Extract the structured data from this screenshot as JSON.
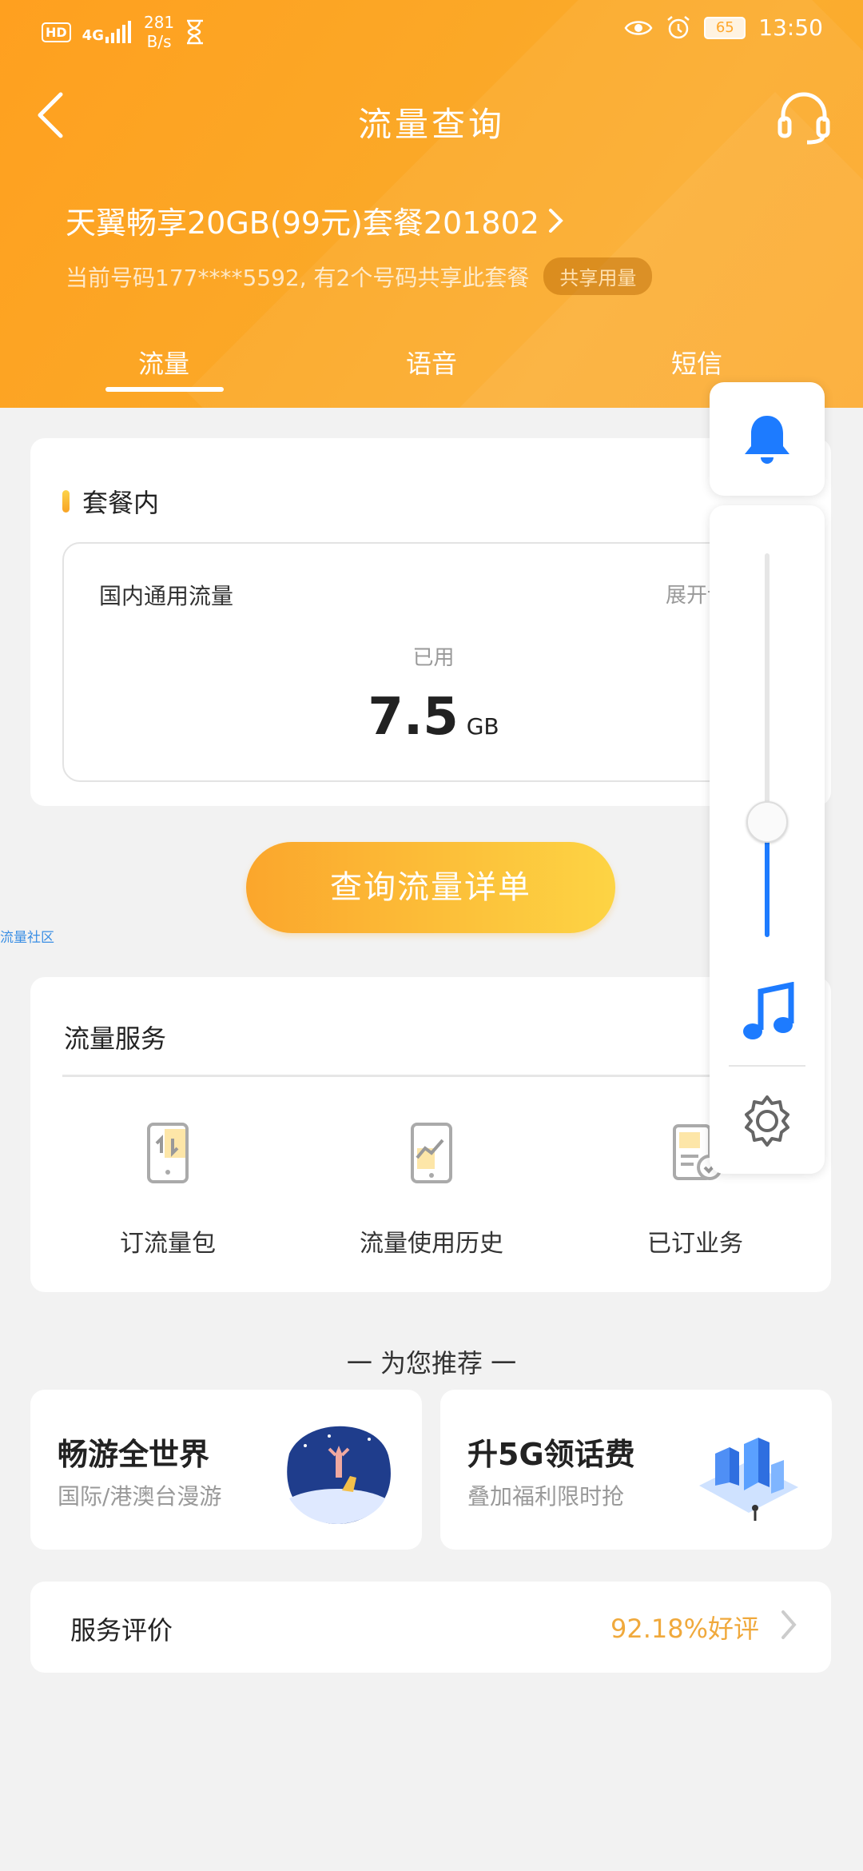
{
  "status_bar": {
    "hd": "HD",
    "network": "4G",
    "speed_value": "281",
    "speed_unit": "B/s",
    "battery": "65",
    "time": "13:50"
  },
  "header": {
    "title": "流量查询",
    "plan_name": "天翼畅享20GB(99元)套餐201802",
    "plan_sub": "当前号码177****5592, 有2个号码共享此套餐",
    "share_badge": "共享用量",
    "bg_color": "#ffa526"
  },
  "tabs": [
    {
      "label": "流量",
      "active": true
    },
    {
      "label": "语音",
      "active": false
    },
    {
      "label": "短信",
      "active": false
    }
  ],
  "package": {
    "section_title": "套餐内",
    "type_label": "国内通用流量",
    "expand_label": "展开详",
    "used_label": "已用",
    "used_value": "7.5",
    "used_unit": "GB"
  },
  "query_button": "查询流量详单",
  "community_link": "流量社区",
  "services": {
    "title": "流量服务",
    "items": [
      {
        "label": "订流量包",
        "icon": "order-package-icon"
      },
      {
        "label": "流量使用历史",
        "icon": "usage-history-icon"
      },
      {
        "label": "已订业务",
        "icon": "subscribed-services-icon"
      }
    ]
  },
  "recommend": {
    "title": "一 为您推荐 一",
    "items": [
      {
        "title": "畅游全世界",
        "subtitle": "国际/港澳台漫游"
      },
      {
        "title": "升5G领话费",
        "subtitle": "叠加福利限时抢"
      }
    ]
  },
  "rating": {
    "label": "服务评价",
    "value": "92.18%好评"
  },
  "float_panel": {
    "volume_level": 0.3,
    "accent": "#1d7bff"
  }
}
